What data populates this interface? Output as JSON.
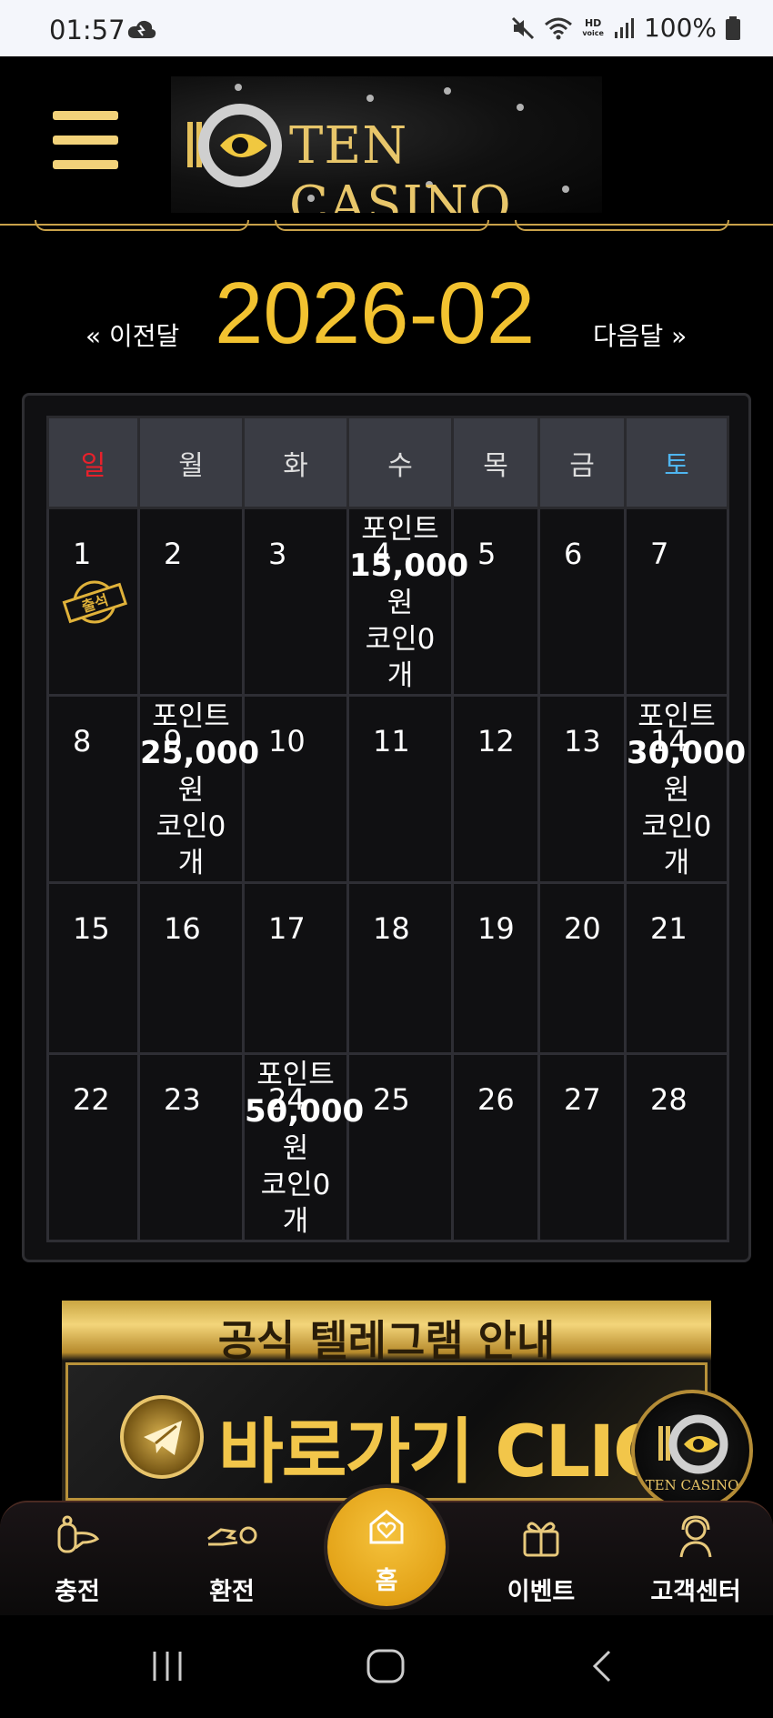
{
  "status_bar": {
    "time": "01:57",
    "battery": "100%",
    "icons": [
      "cloud-icon",
      "mute-icon",
      "wifi-icon",
      "hd-voice-icon",
      "signal-icon",
      "battery-icon"
    ],
    "hd_line1": "HD",
    "hd_line2": "voice"
  },
  "header": {
    "brand": "TEN CASINO",
    "menu_icon": "hamburger-icon"
  },
  "calendar_nav": {
    "prev_label": "« 이전달",
    "month": "2026-02",
    "next_label": "다음달 »"
  },
  "colors": {
    "accent_gold": "#f2c230",
    "sunday_red": "#e8212b",
    "saturday_blue": "#4fb5ef"
  },
  "calendar": {
    "weekdays": [
      "일",
      "월",
      "화",
      "수",
      "목",
      "금",
      "토"
    ],
    "weeks": [
      [
        {
          "day": "1",
          "stamp": "출석"
        },
        {
          "day": "2"
        },
        {
          "day": "3"
        },
        {
          "day": "4",
          "point_label": "포인트",
          "point_amount": "15,000",
          "point_unit": "원",
          "coin": "코인0",
          "coin_unit": "개"
        },
        {
          "day": "5"
        },
        {
          "day": "6"
        },
        {
          "day": "7"
        }
      ],
      [
        {
          "day": "8"
        },
        {
          "day": "9",
          "point_label": "포인트",
          "point_amount": "25,000",
          "point_unit": "원",
          "coin": "코인0",
          "coin_unit": "개"
        },
        {
          "day": "10"
        },
        {
          "day": "11"
        },
        {
          "day": "12"
        },
        {
          "day": "13"
        },
        {
          "day": "14",
          "point_label": "포인트",
          "point_amount": "30,000",
          "point_unit": "원",
          "coin": "코인0",
          "coin_unit": "개"
        }
      ],
      [
        {
          "day": "15"
        },
        {
          "day": "16"
        },
        {
          "day": "17"
        },
        {
          "day": "18"
        },
        {
          "day": "19"
        },
        {
          "day": "20"
        },
        {
          "day": "21"
        }
      ],
      [
        {
          "day": "22"
        },
        {
          "day": "23"
        },
        {
          "day": "24",
          "point_label": "포인트",
          "point_amount": "50,000",
          "point_unit": "원",
          "coin": "코인0",
          "coin_unit": "개"
        },
        {
          "day": "25"
        },
        {
          "day": "26"
        },
        {
          "day": "27"
        },
        {
          "day": "28"
        }
      ]
    ]
  },
  "banner": {
    "title": "공식 텔레그램 안내",
    "cta": "바로가기 CLICK",
    "icon": "telegram-icon"
  },
  "floating_logo": {
    "text": "TEN CASINO"
  },
  "bottom_nav": [
    {
      "label": "충전",
      "icon": "deposit-icon"
    },
    {
      "label": "환전",
      "icon": "withdraw-icon"
    },
    {
      "label": "홈",
      "icon": "home-heart-icon"
    },
    {
      "label": "이벤트",
      "icon": "gift-icon"
    },
    {
      "label": "고객센터",
      "icon": "support-icon"
    }
  ],
  "system_nav": [
    "recent-apps-icon",
    "home-circle-icon",
    "back-icon"
  ]
}
